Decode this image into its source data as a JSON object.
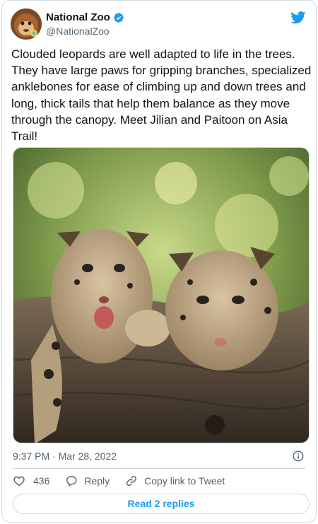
{
  "account": {
    "display_name": "National Zoo",
    "handle": "@NationalZoo",
    "verified": true
  },
  "brand": {
    "twitter_blue": "#1d9bf0",
    "logo_icon": "twitter-bird-icon"
  },
  "tweet": {
    "text": "Clouded leopards are well adapted to life in the trees. They have large paws for gripping branches, specialized anklebones for ease of climbing up and down trees and long, thick tails that help them balance as they move through the canopy. Meet Jilian and Paitoon on Asia Trail!",
    "timestamp": "9:37 PM · Mar 28, 2022"
  },
  "actions": {
    "like_count": "436",
    "reply_label": "Reply",
    "copy_link_label": "Copy link to Tweet"
  },
  "replies_button_label": "Read 2 replies"
}
